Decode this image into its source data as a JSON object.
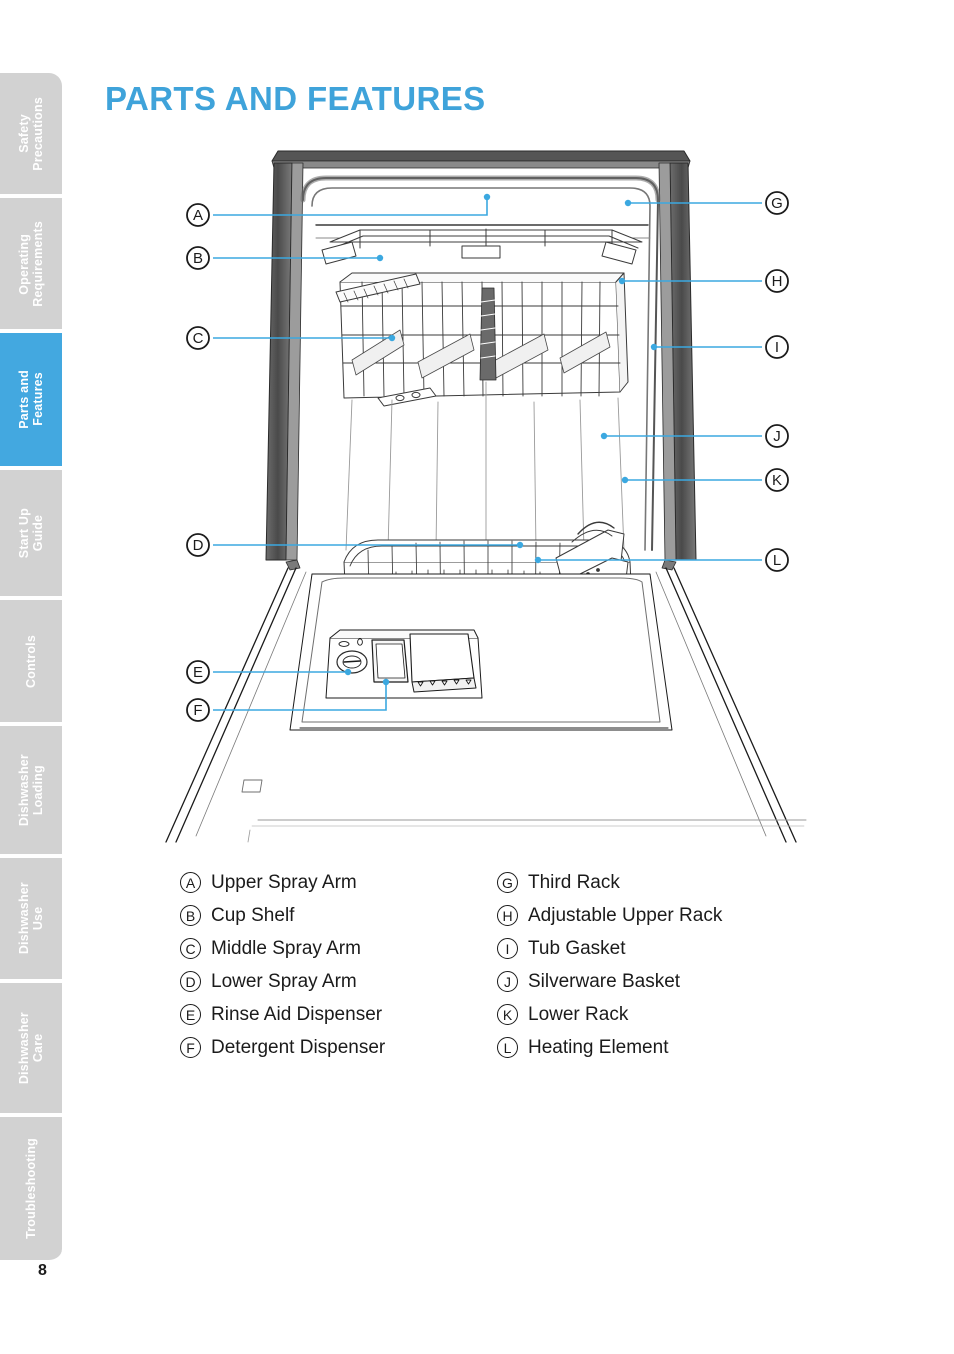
{
  "page": {
    "title": "PARTS AND FEATURES",
    "number": "8",
    "accent_color": "#43a8e0",
    "tab_inactive_color": "#d2d2d2",
    "tab_text_color": "#ffffff",
    "leader_line_color": "#3ba8e0",
    "ink_color": "#1b1b1b"
  },
  "sidebar": {
    "items": [
      {
        "label": "Safety\nPrecautions",
        "active": false
      },
      {
        "label": "Operating\nRequirements",
        "active": false
      },
      {
        "label": "Parts and\nFeatures",
        "active": true
      },
      {
        "label": "Start Up\nGuide",
        "active": false
      },
      {
        "label": "Controls",
        "active": false
      },
      {
        "label": "Dishwasher\nLoading",
        "active": false
      },
      {
        "label": "Dishwasher\nUse",
        "active": false
      },
      {
        "label": "Dishwasher\nCare",
        "active": false
      },
      {
        "label": "Troubleshooting",
        "active": false
      }
    ]
  },
  "legend": {
    "left": [
      {
        "key": "A",
        "label": "Upper Spray Arm"
      },
      {
        "key": "B",
        "label": "Cup Shelf"
      },
      {
        "key": "C",
        "label": "Middle Spray Arm"
      },
      {
        "key": "D",
        "label": "Lower Spray Arm"
      },
      {
        "key": "E",
        "label": "Rinse Aid Dispenser"
      },
      {
        "key": "F",
        "label": "Detergent Dispenser"
      }
    ],
    "right": [
      {
        "key": "G",
        "label": "Third Rack"
      },
      {
        "key": "H",
        "label": "Adjustable Upper Rack"
      },
      {
        "key": "I",
        "label": "Tub Gasket"
      },
      {
        "key": "J",
        "label": "Silverware Basket"
      },
      {
        "key": "K",
        "label": "Lower Rack"
      },
      {
        "key": "L",
        "label": "Heating Element"
      }
    ]
  },
  "diagram": {
    "description": "Line drawing of an open dishwasher viewed from the front with the door lowered, racks visible inside the tub",
    "callouts": [
      {
        "key": "A",
        "side": "left"
      },
      {
        "key": "B",
        "side": "left"
      },
      {
        "key": "C",
        "side": "left"
      },
      {
        "key": "D",
        "side": "left"
      },
      {
        "key": "E",
        "side": "left"
      },
      {
        "key": "F",
        "side": "left"
      },
      {
        "key": "G",
        "side": "right"
      },
      {
        "key": "H",
        "side": "right"
      },
      {
        "key": "I",
        "side": "right"
      },
      {
        "key": "J",
        "side": "right"
      },
      {
        "key": "K",
        "side": "right"
      },
      {
        "key": "L",
        "side": "right"
      }
    ]
  }
}
